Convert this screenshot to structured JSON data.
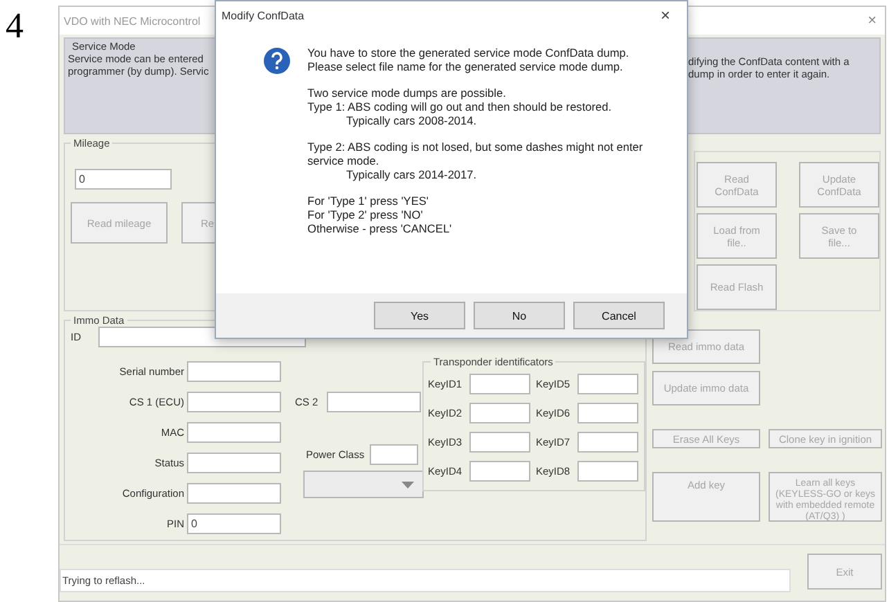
{
  "figure_number": "4",
  "window": {
    "title": "VDO with NEC Microcontrol",
    "close": "×"
  },
  "service_mode": {
    "label": "Service Mode",
    "left_lines": [
      "Service mode can be entered",
      "programmer (by dump). Servic"
    ],
    "right_lines": [
      "difying the ConfData content with a",
      "dump in order to enter it again."
    ]
  },
  "mileage": {
    "label": "Mileage",
    "value": "0",
    "buttons": [
      {
        "label": "Read mileage",
        "disabled": true
      },
      {
        "label": "Re",
        "disabled": true
      }
    ]
  },
  "confdata_buttons": [
    {
      "label": "Read ConfData",
      "disabled": true
    },
    {
      "label": "Update ConfData",
      "disabled": true
    },
    {
      "label": "Load from file..",
      "disabled": true
    },
    {
      "label": "Save to file...",
      "disabled": true
    },
    {
      "label": "Read Flash",
      "disabled": true
    }
  ],
  "immo": {
    "label": "Immo Data",
    "id_label": "ID",
    "fields": [
      {
        "label": "Serial number"
      },
      {
        "label": "CS 1 (ECU)"
      },
      {
        "label": "MAC"
      },
      {
        "label": "Status"
      },
      {
        "label": "Configuration"
      },
      {
        "label": "PIN",
        "value": "0"
      }
    ],
    "cs2_label": "CS 2",
    "power_class_label": "Power Class",
    "transponder": {
      "label": "Transponder identificators",
      "keys": [
        "KeyID1",
        "KeyID5",
        "KeyID2",
        "KeyID6",
        "KeyID3",
        "KeyID7",
        "KeyID4",
        "KeyID8"
      ]
    }
  },
  "immo_buttons": [
    {
      "label": "Read immo data",
      "disabled": true
    },
    {
      "label": "Update immo data",
      "disabled": true
    },
    {
      "label": "Erase All Keys",
      "disabled": true
    },
    {
      "label": "Clone key in ignition",
      "disabled": true
    },
    {
      "label": "Add key",
      "disabled": true
    },
    {
      "label": "Learn all keys (KEYLESS-GO or keys with embedded remote (AT/Q3) )",
      "disabled": true
    }
  ],
  "status": "Trying to reflash...",
  "exit": {
    "label": "Exit",
    "disabled": true
  },
  "dialog": {
    "title": "Modify ConfData",
    "close": "×",
    "paragraphs": [
      [
        {
          "text": "You have to store the generated service mode ConfData dump.",
          "kind": "line"
        },
        {
          "text": "Please select file name for the generated service mode dump.",
          "kind": "line"
        }
      ],
      [
        {
          "text": "Two service mode dumps are possible.",
          "kind": "line"
        },
        {
          "text": "Type 1: ABS coding will go out and then should be restored.",
          "kind": "line"
        },
        {
          "text": "Typically cars 2008-2014.",
          "kind": "indent"
        }
      ],
      [
        {
          "text": "Type 2: ABS coding is not losed, but some dashes might not enter",
          "kind": "line"
        },
        {
          "text": "service mode.",
          "kind": "line"
        },
        {
          "text": "Typically cars 2014-2017.",
          "kind": "indent"
        }
      ],
      [
        {
          "text": "For 'Type 1' press 'YES'",
          "kind": "line"
        },
        {
          "text": "For 'Type 2' press 'NO'",
          "kind": "line"
        },
        {
          "text": "Otherwise - press 'CANCEL'",
          "kind": "line"
        }
      ]
    ],
    "buttons": [
      "Yes",
      "No",
      "Cancel"
    ]
  }
}
